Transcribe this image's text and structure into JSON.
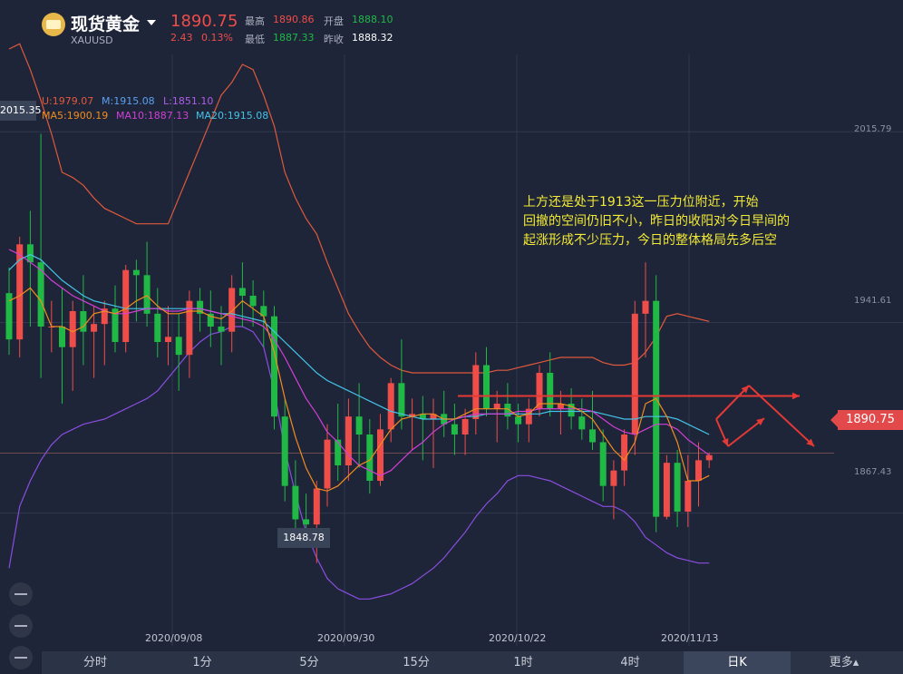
{
  "header": {
    "title": "现货黄金",
    "symbol": "XAUUSD",
    "price": "1890.75",
    "change": "2.43",
    "change_pct": "0.13%",
    "high_label": "最高",
    "high": "1890.86",
    "low_label": "最低",
    "low": "1887.33",
    "open_label": "开盘",
    "open": "1888.10",
    "prev_label": "昨收",
    "prev": "1888.32"
  },
  "indicators": {
    "u": "U:1979.07",
    "m": "M:1915.08",
    "l": "L:1851.10",
    "ma5": "MA5:1900.19",
    "ma10": "MA10:1887.13",
    "ma20": "MA20:1915.08"
  },
  "annotation": "上方还是处于1913这一压力位附近，开始\n回撤的空间仍旧不小，昨日的收阳对今日早间的\n起涨形成不少压力，今日的整体格局先多后空",
  "tags": {
    "current": "1890.75",
    "high_mark": "2015.35",
    "low_mark": "1848.78"
  },
  "price_axis": {
    "t1": "2015.79",
    "t2": "1941.61",
    "t3": "1867.43"
  },
  "dates": [
    "2020/09/08",
    "2020/09/30",
    "2020/10/22",
    "2020/11/13"
  ],
  "tabs": [
    "分时",
    "1分",
    "5分",
    "15分",
    "1时",
    "4时",
    "日K",
    "更多▴"
  ],
  "colors": {
    "up": "#ef4d49",
    "down": "#20b946",
    "ma5": "#f08c1e",
    "ma10": "#d23fd6",
    "ma20": "#44c3e8",
    "boll_upper": "#e0593c",
    "boll_lower": "#8b4de0"
  },
  "chart_data": {
    "type": "candlestick",
    "ylim": [
      1820,
      2060
    ],
    "x_first": "2020/08/26",
    "x_last": "2020/11/24",
    "candles": [
      [
        1953,
        1963,
        1929,
        1935
      ],
      [
        1935,
        1975,
        1928,
        1972
      ],
      [
        1972,
        1985,
        1940,
        1965
      ],
      [
        1965,
        2015,
        1920,
        1940
      ],
      [
        1940,
        1950,
        1930,
        1940
      ],
      [
        1940,
        1955,
        1910,
        1932
      ],
      [
        1932,
        1950,
        1915,
        1946
      ],
      [
        1946,
        1960,
        1925,
        1938
      ],
      [
        1938,
        1948,
        1920,
        1941
      ],
      [
        1941,
        1950,
        1925,
        1947
      ],
      [
        1947,
        1956,
        1930,
        1934
      ],
      [
        1934,
        1964,
        1930,
        1962
      ],
      [
        1962,
        1966,
        1942,
        1960
      ],
      [
        1960,
        1973,
        1940,
        1945
      ],
      [
        1945,
        1955,
        1928,
        1934
      ],
      [
        1934,
        1948,
        1925,
        1936
      ],
      [
        1936,
        1945,
        1915,
        1929
      ],
      [
        1929,
        1954,
        1920,
        1950
      ],
      [
        1950,
        1955,
        1938,
        1945
      ],
      [
        1945,
        1954,
        1932,
        1940
      ],
      [
        1940,
        1948,
        1925,
        1938
      ],
      [
        1938,
        1960,
        1930,
        1955
      ],
      [
        1955,
        1965,
        1940,
        1952
      ],
      [
        1952,
        1958,
        1940,
        1948
      ],
      [
        1948,
        1954,
        1932,
        1944
      ],
      [
        1944,
        1948,
        1900,
        1905
      ],
      [
        1905,
        1912,
        1872,
        1878
      ],
      [
        1878,
        1888,
        1860,
        1865
      ],
      [
        1865,
        1875,
        1855,
        1863
      ],
      [
        1863,
        1880,
        1848,
        1877
      ],
      [
        1877,
        1902,
        1870,
        1896
      ],
      [
        1896,
        1910,
        1880,
        1886
      ],
      [
        1886,
        1912,
        1880,
        1905
      ],
      [
        1905,
        1918,
        1885,
        1898
      ],
      [
        1898,
        1904,
        1875,
        1880
      ],
      [
        1880,
        1906,
        1878,
        1900
      ],
      [
        1900,
        1920,
        1895,
        1918
      ],
      [
        1918,
        1935,
        1900,
        1905
      ],
      [
        1905,
        1912,
        1892,
        1906
      ],
      [
        1906,
        1913,
        1888,
        1904
      ],
      [
        1904,
        1912,
        1885,
        1906
      ],
      [
        1906,
        1915,
        1897,
        1902
      ],
      [
        1902,
        1910,
        1890,
        1898
      ],
      [
        1898,
        1908,
        1890,
        1904
      ],
      [
        1904,
        1930,
        1898,
        1925
      ],
      [
        1925,
        1932,
        1905,
        1908
      ],
      [
        1908,
        1915,
        1895,
        1910
      ],
      [
        1910,
        1918,
        1900,
        1905
      ],
      [
        1905,
        1910,
        1895,
        1902
      ],
      [
        1902,
        1912,
        1895,
        1908
      ],
      [
        1908,
        1925,
        1905,
        1922
      ],
      [
        1922,
        1930,
        1905,
        1908
      ],
      [
        1908,
        1915,
        1898,
        1910
      ],
      [
        1910,
        1916,
        1900,
        1905
      ],
      [
        1905,
        1912,
        1896,
        1900
      ],
      [
        1900,
        1915,
        1892,
        1895
      ],
      [
        1895,
        1900,
        1872,
        1878
      ],
      [
        1878,
        1888,
        1865,
        1884
      ],
      [
        1884,
        1900,
        1878,
        1898
      ],
      [
        1898,
        1950,
        1890,
        1945
      ],
      [
        1945,
        1965,
        1928,
        1950
      ],
      [
        1950,
        1960,
        1860,
        1866
      ],
      [
        1866,
        1890,
        1865,
        1887
      ],
      [
        1887,
        1892,
        1862,
        1868
      ],
      [
        1868,
        1890,
        1862,
        1880
      ],
      [
        1880,
        1895,
        1870,
        1888
      ],
      [
        1888,
        1891,
        1885,
        1890
      ]
    ],
    "ma5": [
      1950,
      1952,
      1955,
      1950,
      1940,
      1940,
      1938,
      1940,
      1945,
      1946,
      1945,
      1947,
      1950,
      1952,
      1948,
      1945,
      1945,
      1946,
      1946,
      1944,
      1943,
      1946,
      1950,
      1947,
      1944,
      1930,
      1912,
      1897,
      1885,
      1877,
      1876,
      1878,
      1882,
      1886,
      1888,
      1894,
      1900,
      1904,
      1905,
      1906,
      1906,
      1904,
      1904,
      1906,
      1908,
      1908,
      1908,
      1908,
      1905,
      1906,
      1910,
      1910,
      1910,
      1909,
      1907,
      1904,
      1898,
      1892,
      1888,
      1895,
      1910,
      1912,
      1905,
      1895,
      1880,
      1880,
      1882
    ],
    "ma10": [
      1970,
      1968,
      1965,
      1962,
      1958,
      1955,
      1952,
      1950,
      1948,
      1946,
      1945,
      1945,
      1946,
      1947,
      1947,
      1946,
      1946,
      1947,
      1947,
      1946,
      1945,
      1944,
      1943,
      1942,
      1940,
      1935,
      1928,
      1920,
      1912,
      1906,
      1899,
      1895,
      1890,
      1886,
      1884,
      1882,
      1884,
      1888,
      1892,
      1895,
      1899,
      1902,
      1904,
      1905,
      1906,
      1906,
      1906,
      1906,
      1907,
      1907,
      1908,
      1908,
      1908,
      1908,
      1908,
      1907,
      1904,
      1901,
      1899,
      1898,
      1900,
      1902,
      1902,
      1900,
      1896,
      1893,
      1890
    ],
    "ma20": [
      1962,
      1966,
      1968,
      1966,
      1962,
      1958,
      1955,
      1952,
      1950,
      1949,
      1948,
      1947,
      1947,
      1947,
      1947,
      1947,
      1947,
      1947,
      1947,
      1946,
      1945,
      1945,
      1944,
      1943,
      1942,
      1938,
      1934,
      1930,
      1926,
      1922,
      1919,
      1917,
      1915,
      1913,
      1911,
      1909,
      1907,
      1906,
      1905,
      1904,
      1904,
      1904,
      1904,
      1905,
      1905,
      1906,
      1906,
      1906,
      1906,
      1906,
      1906,
      1907,
      1907,
      1907,
      1907,
      1907,
      1906,
      1905,
      1904,
      1904,
      1905,
      1905,
      1905,
      1904,
      1902,
      1900,
      1898
    ],
    "boll_upper": [
      2048,
      2050,
      2040,
      2028,
      2015,
      2000,
      1998,
      1995,
      1990,
      1986,
      1984,
      1982,
      1980,
      1980,
      1980,
      1980,
      1990,
      2000,
      2010,
      2020,
      2030,
      2035,
      2042,
      2040,
      2030,
      2018,
      2000,
      1990,
      1982,
      1976,
      1965,
      1955,
      1945,
      1938,
      1932,
      1928,
      1925,
      1923,
      1922,
      1922,
      1922,
      1922,
      1922,
      1922,
      1922,
      1922,
      1923,
      1923,
      1924,
      1925,
      1926,
      1927,
      1928,
      1928,
      1928,
      1928,
      1926,
      1925,
      1925,
      1926,
      1930,
      1936,
      1944,
      1945,
      1944,
      1943,
      1942
    ],
    "boll_lower": [
      1846,
      1870,
      1880,
      1888,
      1894,
      1898,
      1900,
      1902,
      1903,
      1904,
      1906,
      1908,
      1910,
      1912,
      1915,
      1920,
      1925,
      1930,
      1934,
      1937,
      1938,
      1940,
      1940,
      1938,
      1932,
      1915,
      1892,
      1875,
      1860,
      1850,
      1842,
      1838,
      1836,
      1834,
      1834,
      1835,
      1836,
      1838,
      1840,
      1843,
      1846,
      1850,
      1855,
      1860,
      1866,
      1871,
      1875,
      1880,
      1882,
      1882,
      1881,
      1880,
      1878,
      1876,
      1874,
      1872,
      1870,
      1870,
      1868,
      1864,
      1858,
      1855,
      1852,
      1850,
      1849,
      1848,
      1848
    ],
    "horizontal_line": 1913
  }
}
